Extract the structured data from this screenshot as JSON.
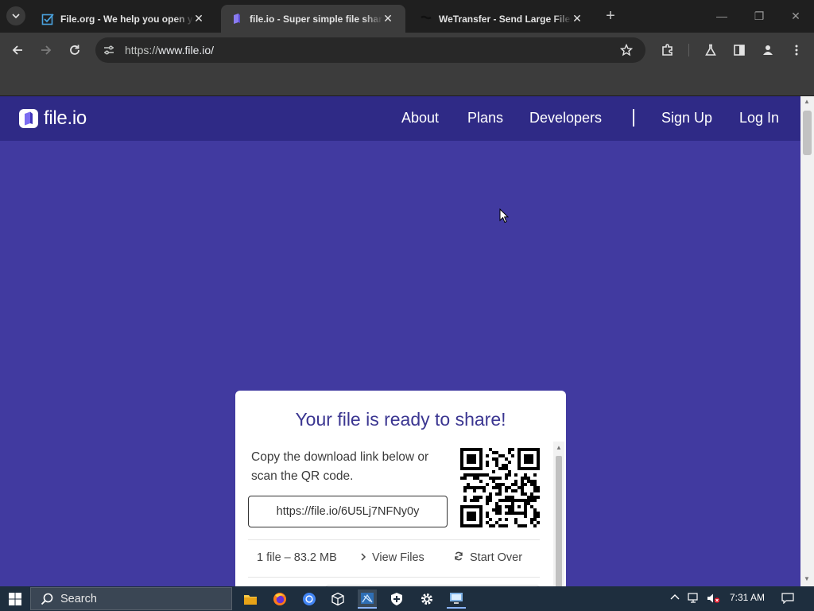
{
  "browser": {
    "tabs": [
      {
        "title": "File.org - We help you open yo",
        "active": false
      },
      {
        "title": "file.io - Super simple file sharing",
        "active": true
      },
      {
        "title": "WeTransfer - Send Large Files & Share Photos",
        "active": false
      }
    ],
    "tab_close_glyph": "✕",
    "new_tab_glyph": "+",
    "window_controls": {
      "minimize": "—",
      "restore": "❐",
      "close": "✕"
    },
    "address": {
      "scheme": "https://",
      "host": "www.file.io/"
    }
  },
  "site": {
    "logo_text": "file.io",
    "nav": {
      "about": "About",
      "plans": "Plans",
      "developers": "Developers",
      "signup": "Sign Up",
      "login": "Log In"
    }
  },
  "card": {
    "title": "Your file is ready to share!",
    "description": "Copy the download link below or scan the QR code.",
    "link": "https://file.io/6U5Lj7NFNy0y",
    "file_info": "1 file – 83.2 MB",
    "view_files": "View Files",
    "start_over": "Start Over"
  },
  "taskbar": {
    "search_label": "Search",
    "clock": "7:31 AM"
  },
  "colors": {
    "page_bg": "#413aa0",
    "nav_bg": "#2f2a86",
    "card_title": "#3b3691",
    "taskbar_bg": "#1e2e3e"
  }
}
